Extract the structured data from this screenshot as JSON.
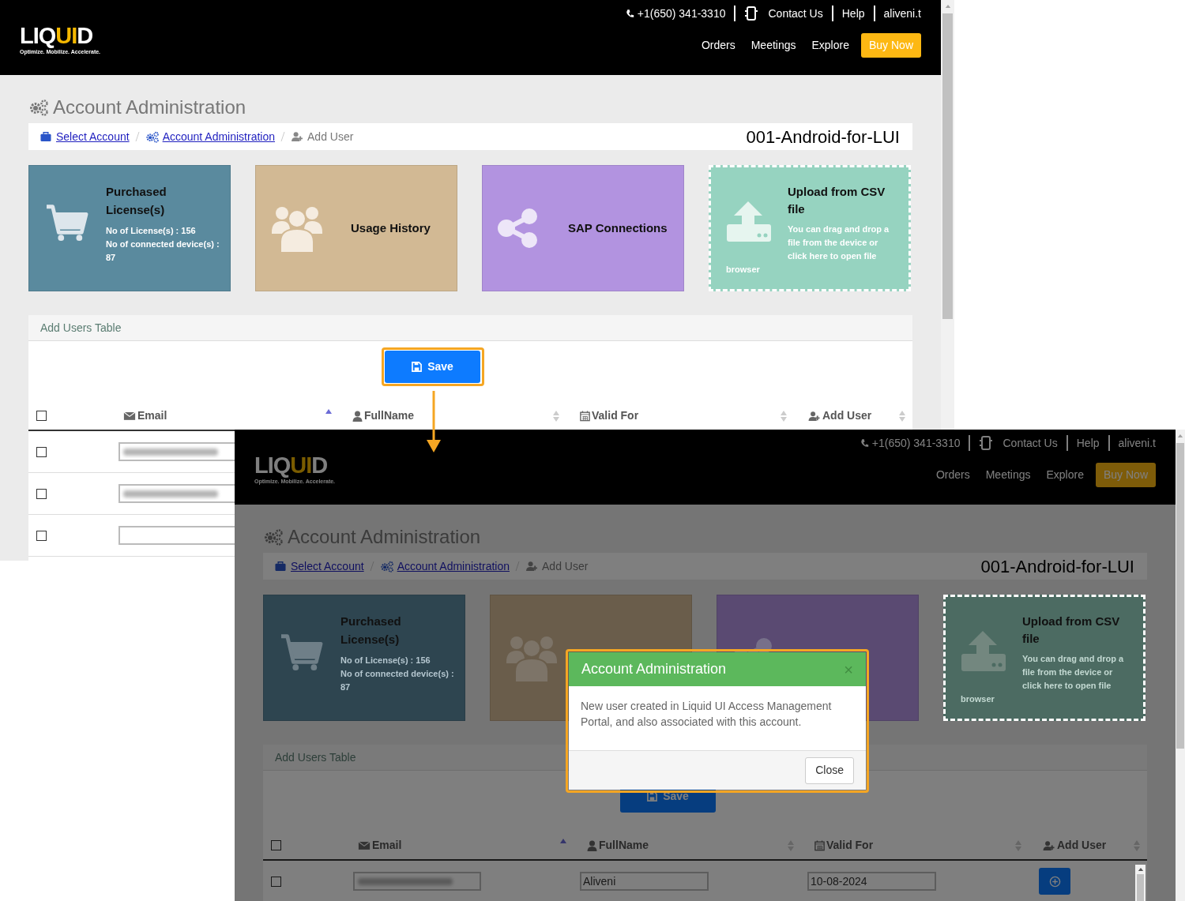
{
  "screens": [
    {
      "logo": [
        {
          "text": "LIQ",
          "highlight": false
        },
        {
          "text": "UI",
          "highlight": true
        },
        {
          "text": "D",
          "highlight": false
        }
      ],
      "tagline": "Optimize. Mobilize. Accelerate.",
      "phone": "+1(650) 341-3310",
      "top_links": [
        "Contact Us",
        "Help",
        "aliveni.t"
      ],
      "nav": [
        "Orders",
        "Meetings",
        "Explore"
      ],
      "cta": "Buy Now",
      "page_title": "Account Administration",
      "breadcrumb": [
        {
          "label": "Select Account",
          "kind": "link"
        },
        {
          "label": "Account Administration",
          "kind": "link"
        },
        {
          "label": "Add User",
          "kind": "current"
        }
      ],
      "account": "001-Android-for-LUI",
      "cards": [
        {
          "kind": "stats",
          "color": "#5a8a9e",
          "title": "Purchased License(s)",
          "details": [
            "No of License(s) : 156",
            "No of connected device(s) : 87"
          ]
        },
        {
          "kind": "plain",
          "color": "#d2b994",
          "title": "Usage History"
        },
        {
          "kind": "plain",
          "color": "#b293e0",
          "title": "SAP Connections"
        },
        {
          "kind": "upload",
          "color": "#96d3c0",
          "title": "Upload from CSV file",
          "details": [
            "You can drag and drop a file from the device or click here to open file browser"
          ]
        }
      ],
      "table": {
        "title": "Add Users Table",
        "save": {
          "label": "Save",
          "highlighted": true
        },
        "columns": [
          {
            "kind": "select",
            "checked": false
          },
          {
            "label": "Email",
            "sorted": true
          },
          {
            "label": "FullName",
            "sorted": false
          },
          {
            "label": "Valid For",
            "sorted": false
          },
          {
            "label": "Add User",
            "sorted": false
          }
        ],
        "rows": [
          {
            "checked": false,
            "email": {
              "blurred": true
            }
          },
          {
            "checked": false,
            "email": {
              "blurred": true
            }
          },
          {
            "checked": false,
            "email": {
              "blurred": false
            }
          }
        ]
      }
    },
    {
      "logo": [
        {
          "text": "LIQ",
          "highlight": false
        },
        {
          "text": "UI",
          "highlight": true
        },
        {
          "text": "D",
          "highlight": false
        }
      ],
      "tagline": "Optimize. Mobilize. Accelerate.",
      "phone": "+1(650) 341-3310",
      "top_links": [
        "Contact Us",
        "Help",
        "aliveni.t"
      ],
      "nav": [
        "Orders",
        "Meetings",
        "Explore"
      ],
      "cta": "Buy Now",
      "page_title": "Account Administration",
      "breadcrumb": [
        {
          "label": "Select Account",
          "kind": "link"
        },
        {
          "label": "Account Administration",
          "kind": "link"
        },
        {
          "label": "Add User",
          "kind": "current"
        }
      ],
      "account": "001-Android-for-LUI",
      "cards": [
        {
          "kind": "stats",
          "color": "#2e4550",
          "title": "Purchased License(s)",
          "details": [
            "No of License(s) : 156",
            "No of connected device(s) : 87"
          ]
        },
        {
          "kind": "plain",
          "color": "#6a5d4b"
        },
        {
          "kind": "plain",
          "color": "#5a4a72"
        },
        {
          "kind": "upload",
          "color": "#4c6b62",
          "title": "Upload from CSV file",
          "details": [
            "You can drag and drop a file from the device or click here to open file browser"
          ]
        }
      ],
      "table": {
        "title": "Add Users Table",
        "save": {
          "label": "Save",
          "highlighted": false
        },
        "columns": [
          {
            "kind": "select",
            "checked": false
          },
          {
            "label": "Email",
            "sorted": true
          },
          {
            "label": "FullName",
            "sorted": false
          },
          {
            "label": "Valid For",
            "sorted": false
          },
          {
            "label": "Add User",
            "sorted": false
          }
        ],
        "rows": [
          {
            "checked": false,
            "email": {
              "blurred": true
            },
            "full_name": "Aliveni",
            "valid_for": "10-08-2024",
            "add_button": true
          }
        ]
      },
      "modal": {
        "title": "Account Administration",
        "close": "×",
        "message": "New user created in Liquid UI Access Management Portal, and also associated with this account.",
        "button": "Close",
        "highlighted": true
      }
    }
  ],
  "callout_arrow": true
}
